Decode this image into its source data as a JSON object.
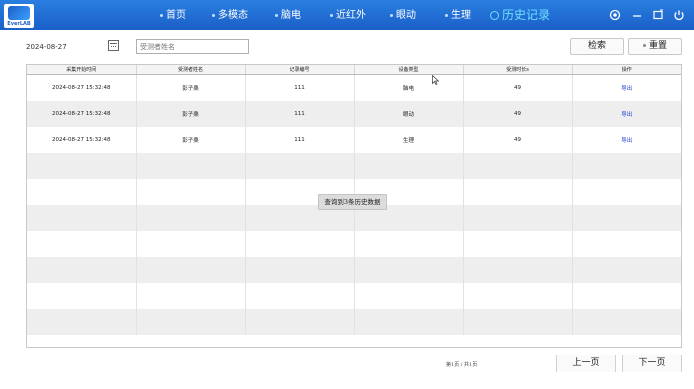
{
  "brand": {
    "logo_text": "EverLAB"
  },
  "nav": {
    "items": [
      {
        "label": "首页",
        "active": false
      },
      {
        "label": "多模态",
        "active": false
      },
      {
        "label": "脑电",
        "active": false
      },
      {
        "label": "近红外",
        "active": false
      },
      {
        "label": "眼动",
        "active": false
      },
      {
        "label": "生理",
        "active": false
      },
      {
        "label": "历史记录",
        "active": true
      }
    ]
  },
  "window_controls": {
    "settings": "settings-icon",
    "minimize": "minimize-icon",
    "restore": "restore-icon",
    "power": "power-icon"
  },
  "filters": {
    "date_value": "2024-08-27",
    "name_placeholder": "受测者姓名",
    "search_label": "检索",
    "reset_label": "重置"
  },
  "table": {
    "columns": [
      "采集开始时间",
      "受测者姓名",
      "记录编号",
      "设备类型",
      "受测时长s",
      "操作"
    ],
    "rows": [
      [
        "2024-08-27 15:32:48",
        "彭子桑",
        "111",
        "脑电",
        "49",
        "导出"
      ],
      [
        "2024-08-27 15:32:48",
        "彭子桑",
        "111",
        "眼动",
        "49",
        "导出"
      ],
      [
        "2024-08-27 15:32:48",
        "彭子桑",
        "111",
        "生理",
        "49",
        "导出"
      ]
    ],
    "empty_rows": 7
  },
  "toast": {
    "text": "查询到3条历史数据"
  },
  "pagination": {
    "info": "第1页 / 共1页",
    "prev_label": "上一页",
    "next_label": "下一页"
  },
  "colors": {
    "header_blue": "#1a5fc8",
    "active_nav": "#6fe0ff",
    "link_blue": "#1a3fd0"
  }
}
